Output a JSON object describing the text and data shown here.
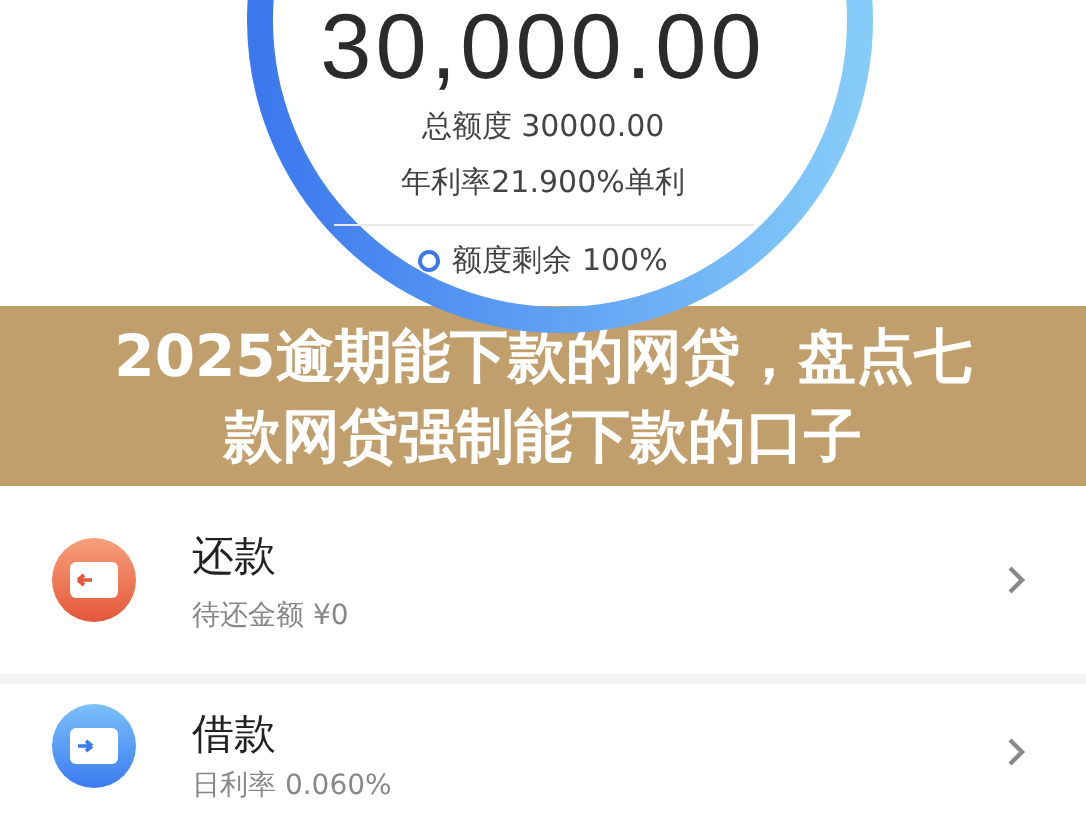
{
  "credit": {
    "amount": "30,000.00",
    "total": "总额度 30000.00",
    "rate": "年利率21.900%单利",
    "remaining": "额度剩余 100%"
  },
  "banner": {
    "title": "2025逾期能下款的网贷，盘点七款网贷强制能下款的口子"
  },
  "items": [
    {
      "kind": "repay",
      "title": "还款",
      "subtitle": "待还金额 ¥0"
    },
    {
      "kind": "borrow",
      "title": "借款",
      "subtitle": "日利率 0.060%"
    }
  ]
}
